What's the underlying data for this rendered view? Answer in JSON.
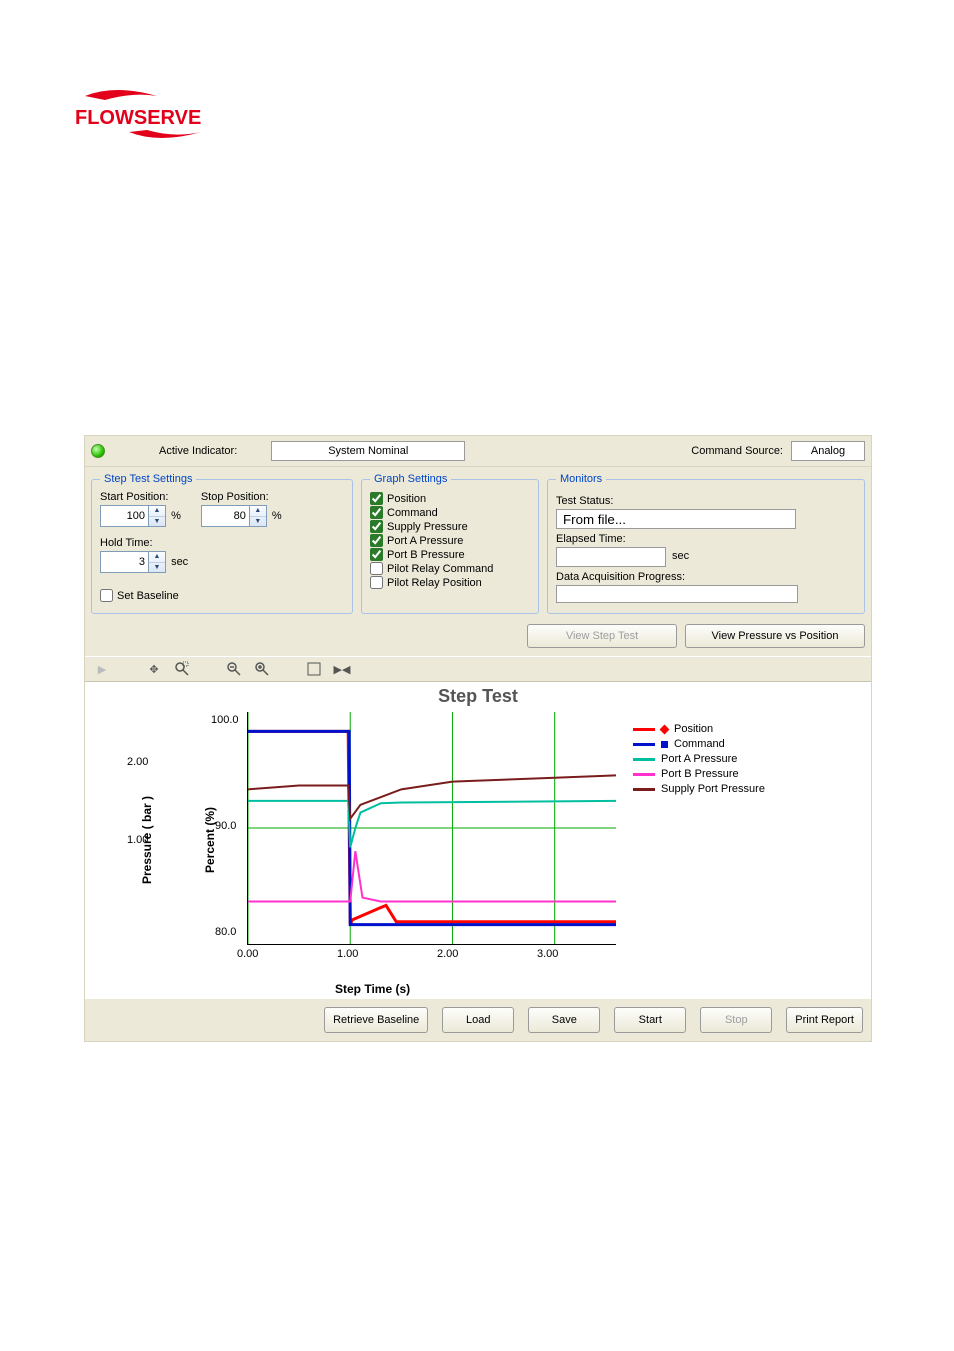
{
  "logo_text": "FLOWSERVE",
  "statusbar": {
    "active_indicator_label": "Active Indicator:",
    "active_indicator_value": "System Nominal",
    "command_source_label": "Command Source:",
    "command_source_value": "Analog"
  },
  "step_settings": {
    "legend": "Step Test Settings",
    "start_position_label": "Start Position:",
    "start_position_value": "100",
    "start_position_unit": "%",
    "stop_position_label": "Stop Position:",
    "stop_position_value": "80",
    "stop_position_unit": "%",
    "hold_time_label": "Hold Time:",
    "hold_time_value": "3",
    "hold_time_unit": "sec",
    "set_baseline_label": "Set Baseline",
    "set_baseline_checked": false
  },
  "graph_settings": {
    "legend": "Graph Settings",
    "options": [
      {
        "label": "Position",
        "checked": true
      },
      {
        "label": "Command",
        "checked": true
      },
      {
        "label": "Supply Pressure",
        "checked": true
      },
      {
        "label": "Port A Pressure",
        "checked": true
      },
      {
        "label": "Port B Pressure",
        "checked": true
      },
      {
        "label": "Pilot Relay Command",
        "checked": false
      },
      {
        "label": "Pilot Relay Position",
        "checked": false
      }
    ]
  },
  "monitors": {
    "legend": "Monitors",
    "test_status_label": "Test Status:",
    "test_status_value": "From file...",
    "elapsed_time_label": "Elapsed Time:",
    "elapsed_time_unit": "sec",
    "daq_label": "Data Acquisition Progress:"
  },
  "view_tabs": {
    "step": "View Step Test",
    "pvp": "View Pressure vs Position"
  },
  "chart_data": {
    "type": "line",
    "title": "Step Test",
    "xlabel": "Step Time (s)",
    "y1_label": "Pressure ( bar )",
    "y2_label": "Percent (%)",
    "x_ticks": [
      "0.00",
      "1.00",
      "2.00",
      "3.00"
    ],
    "y1_ticks": [
      "1.00",
      "2.00"
    ],
    "y2_ticks": [
      "80.0",
      "90.0",
      "100.0"
    ],
    "xlim": [
      0,
      3.6
    ],
    "y1_lim": [
      0,
      3
    ],
    "y2_lim": [
      78,
      102
    ],
    "series": [
      {
        "name": "Position",
        "axis": "y2",
        "color": "#ff0000",
        "x": [
          0,
          0.5,
          0.98,
          1.0,
          1.02,
          1.35,
          1.45,
          3.6
        ],
        "y": [
          100,
          100,
          100,
          80,
          80.5,
          82,
          80.3,
          80.3
        ]
      },
      {
        "name": "Command",
        "axis": "y2",
        "color": "#0011cc",
        "x": [
          0,
          0.99,
          1.0,
          3.6
        ],
        "y": [
          100,
          100,
          80,
          80
        ]
      },
      {
        "name": "Port A Pressure",
        "axis": "y1",
        "color": "#00bfa0",
        "x": [
          0,
          0.98,
          1.0,
          1.05,
          1.1,
          1.3,
          1.5,
          3.6
        ],
        "y": [
          1.85,
          1.85,
          1.25,
          1.5,
          1.7,
          1.82,
          1.83,
          1.85
        ]
      },
      {
        "name": "Port B Pressure",
        "axis": "y1",
        "color": "#ff33cc",
        "x": [
          0,
          0.98,
          1.0,
          1.05,
          1.12,
          1.3,
          3.6
        ],
        "y": [
          0.55,
          0.55,
          0.55,
          1.2,
          0.6,
          0.55,
          0.55
        ]
      },
      {
        "name": "Supply Port Pressure",
        "axis": "y1",
        "color": "#7a1c1c",
        "x": [
          0,
          0.5,
          0.98,
          1.0,
          1.1,
          1.5,
          2.0,
          3.0,
          3.6
        ],
        "y": [
          2.0,
          2.05,
          2.05,
          1.62,
          1.8,
          2.0,
          2.1,
          2.15,
          2.18
        ]
      }
    ],
    "legend_items": [
      {
        "name": "Position",
        "color": "#ff0000",
        "marker": "diamond"
      },
      {
        "name": "Command",
        "color": "#0011cc",
        "marker": "square"
      },
      {
        "name": "Port A Pressure",
        "color": "#00bfa0"
      },
      {
        "name": "Port B Pressure",
        "color": "#ff33cc"
      },
      {
        "name": "Supply Port Pressure",
        "color": "#7a1c1c"
      }
    ]
  },
  "actions": {
    "retrieve_baseline": "Retrieve\nBaseline",
    "load": "Load",
    "save": "Save",
    "start": "Start",
    "stop": "Stop",
    "print_report": "Print Report"
  }
}
